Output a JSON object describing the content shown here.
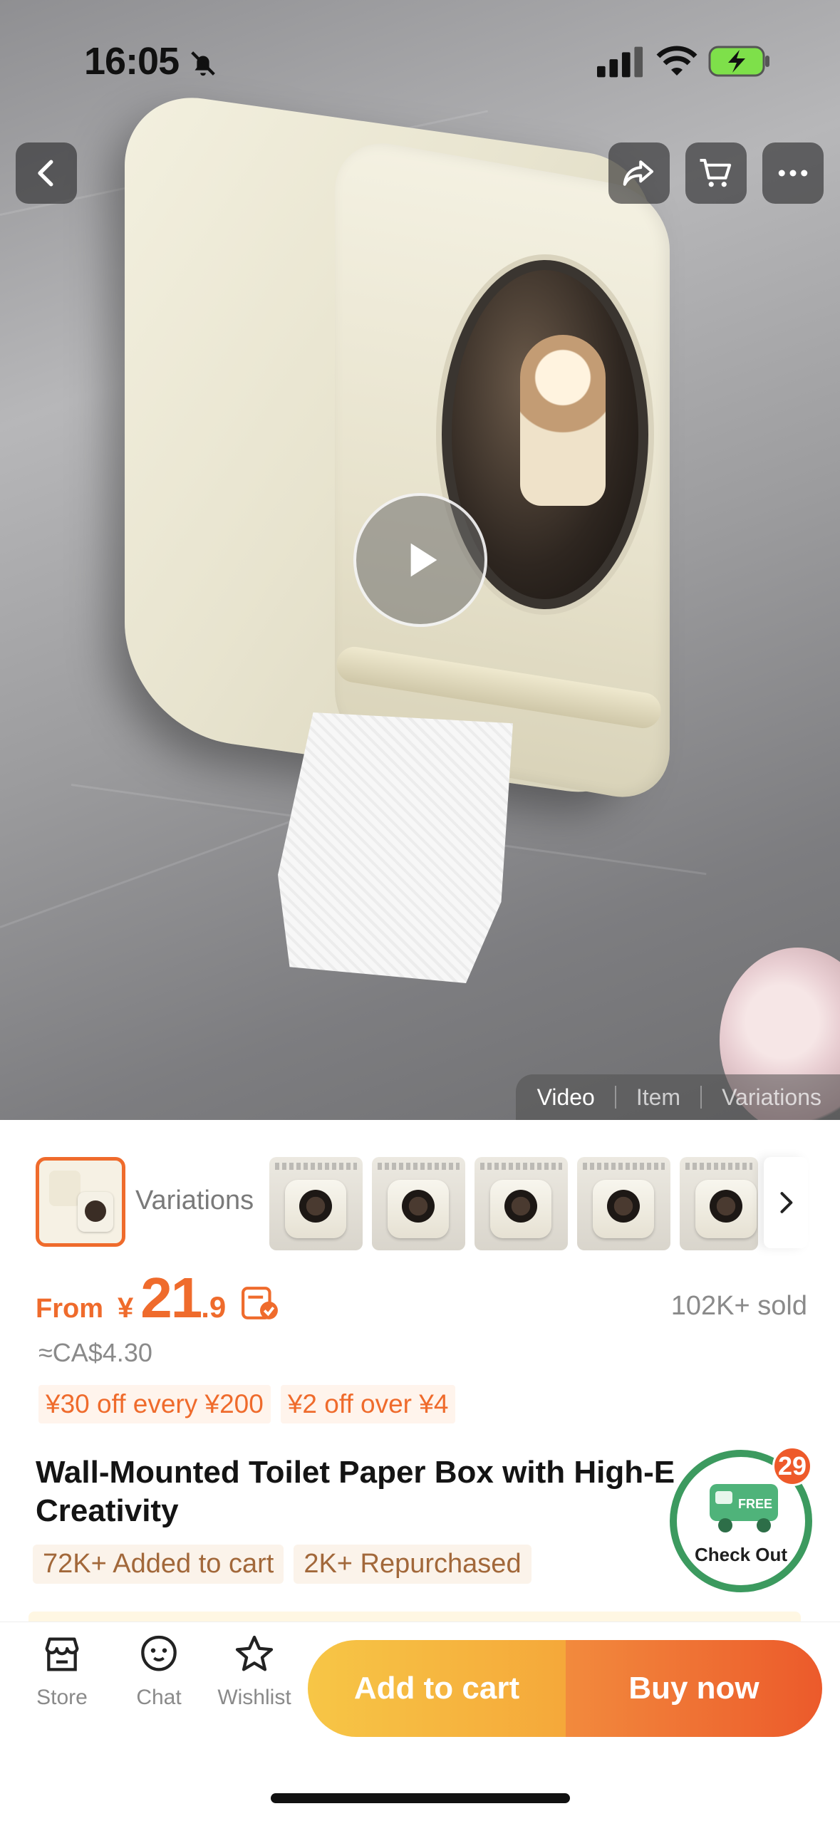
{
  "status_bar": {
    "time": "16:05"
  },
  "hero": {
    "media_tabs": [
      {
        "label": "Video",
        "active": true
      },
      {
        "label": "Item",
        "active": false
      },
      {
        "label": "Variations",
        "active": false
      }
    ]
  },
  "variations": {
    "label": "Variations",
    "thumbnail_count": 5
  },
  "price": {
    "from": "From",
    "currency": "¥",
    "integer": "21",
    "decimal": ".9",
    "sold": "102K+ sold",
    "approx": "≈CA$4.30",
    "promos": [
      "¥30 off every ¥200",
      "¥2 off over ¥4"
    ]
  },
  "product": {
    "title_line1": "Wall-Mounted Toilet Paper Box with High-E",
    "title_line2": "Creativity",
    "tags": [
      "72K+ Added to cart",
      "2K+ Repurchased"
    ]
  },
  "checkout": {
    "badge_text": "FREE",
    "label": "Check Out",
    "cart_count": "29"
  },
  "bottom_bar": {
    "store": "Store",
    "chat": "Chat",
    "wishlist": "Wishlist",
    "add_to_cart": "Add to cart",
    "buy_now": "Buy now"
  },
  "colors": {
    "accent": "#ef6b2c",
    "checkout_green": "#3c9a5f",
    "cart_yellow": "#f7c646",
    "buy_orange": "#ec5a2b"
  },
  "icons": [
    "bell-slash-icon",
    "signal-icon",
    "wifi-icon",
    "battery-charging-icon",
    "back-icon",
    "share-icon",
    "cart-icon",
    "more-icon",
    "play-icon",
    "chevron-right-icon",
    "coupon-icon",
    "truck-icon",
    "store-icon",
    "chat-icon",
    "star-icon"
  ]
}
